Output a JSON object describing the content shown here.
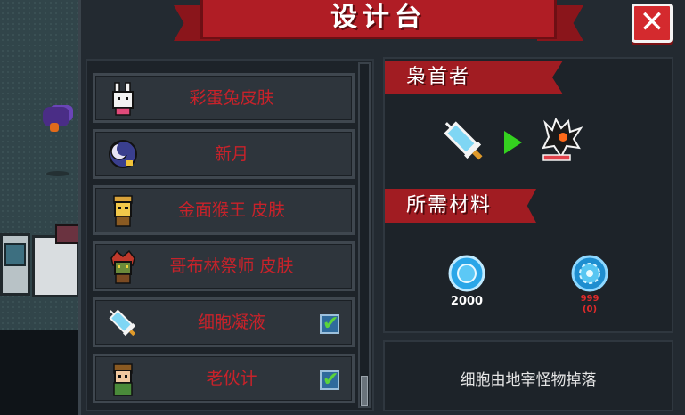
{
  "title": "设计台",
  "close_label": "✕",
  "items": [
    {
      "label": "彩蛋兔皮肤",
      "checked": false,
      "icon": "bunny-skin-icon"
    },
    {
      "label": "新月",
      "checked": false,
      "icon": "crescent-moon-icon"
    },
    {
      "label": "金面猴王 皮肤",
      "checked": false,
      "icon": "monkey-king-skin-icon"
    },
    {
      "label": "哥布林祭师 皮肤",
      "checked": false,
      "icon": "goblin-priest-skin-icon"
    },
    {
      "label": "细胞凝液",
      "checked": true,
      "icon": "syringe-icon"
    },
    {
      "label": "老伙计",
      "checked": true,
      "icon": "old-buddy-icon"
    }
  ],
  "detail": {
    "target_name": "枭首者",
    "materials_label": "所需材料",
    "materials": [
      {
        "icon": "gem-currency-icon",
        "amount": "2000"
      },
      {
        "icon": "cell-material-icon",
        "amount": "999",
        "owned": "(0)"
      }
    ],
    "description": "细胞由地宰怪物掉落"
  },
  "colors": {
    "banner_red": "#b01d25",
    "item_text_red": "#c8222a",
    "check_green": "#5bd43a",
    "arrow_green": "#34d11f",
    "panel_bg": "#232a31"
  }
}
